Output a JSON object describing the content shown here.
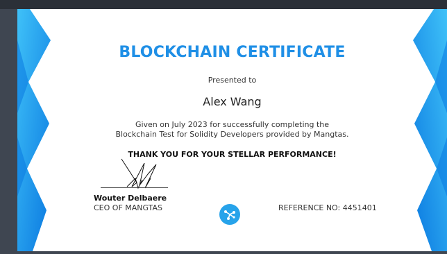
{
  "certificate": {
    "title": "BLOCKCHAIN CERTIFICATE",
    "presented_to": "Presented to",
    "recipient": "Alex Wang",
    "given_line1": "Given on July 2023 for successfully completing the",
    "given_line2": "Blockchain Test for Solidity Developers provided by Mangtas.",
    "thanks": "THANK YOU FOR YOUR STELLAR PERFORMANCE!",
    "signer_name": "Wouter Delbaere",
    "signer_title": "CEO OF MANGTAS",
    "reference": "REFERENCE NO: 4451401"
  },
  "colors": {
    "title": "#1f8fe6",
    "ribbon_dark": "#0a78e0",
    "ribbon_light": "#3fc1f8",
    "logo": "#27a3ea",
    "backdrop": "#3f4651"
  },
  "icons": {
    "logo": "mangtas-logo-icon",
    "signature": "signature"
  }
}
